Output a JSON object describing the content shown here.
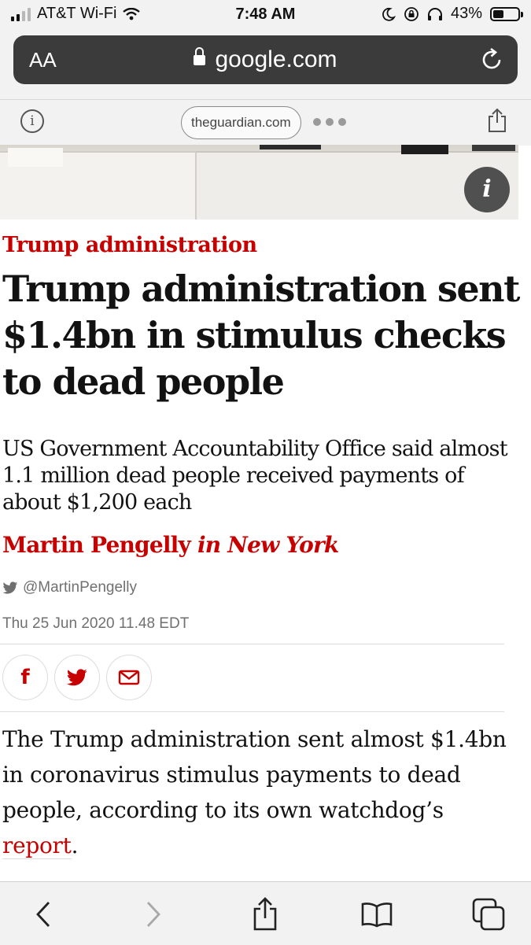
{
  "status_bar": {
    "carrier": "AT&T Wi-Fi",
    "time": "7:48 AM",
    "battery_text": "43%",
    "battery_level": 0.43
  },
  "browser": {
    "text_size_label": "AA",
    "url": "google.com",
    "reader_domain": "theguardian.com"
  },
  "article": {
    "image_info_label": "i",
    "kicker": "Trump administration",
    "headline": "Trump administration sent $1.4bn in stimulus checks to dead people",
    "standfirst": "US Government Accountability Office said almost 1.1 million dead people received payments of about $1,200 each",
    "author": "Martin Pengelly",
    "location": "in New York",
    "twitter_handle": "@MartinPengelly",
    "date": "Thu 25 Jun 2020 11.48 EDT",
    "body_before_link": "The Trump administration sent almost $1.4bn in coronavirus stimulus payments to dead people, according to its own watchdog’s ",
    "body_link": "report",
    "body_after_link": "."
  },
  "share": {
    "facebook_glyph": "f",
    "icons": [
      "facebook-icon",
      "twitter-icon",
      "email-icon"
    ]
  },
  "toolbar": {
    "icons": [
      "back-icon",
      "forward-icon",
      "share-icon",
      "bookmarks-icon",
      "tabs-icon"
    ]
  },
  "colors": {
    "guardian_red": "#c70000",
    "url_bar": "#3b3b3b",
    "chrome_gray": "#f2f2f2"
  }
}
